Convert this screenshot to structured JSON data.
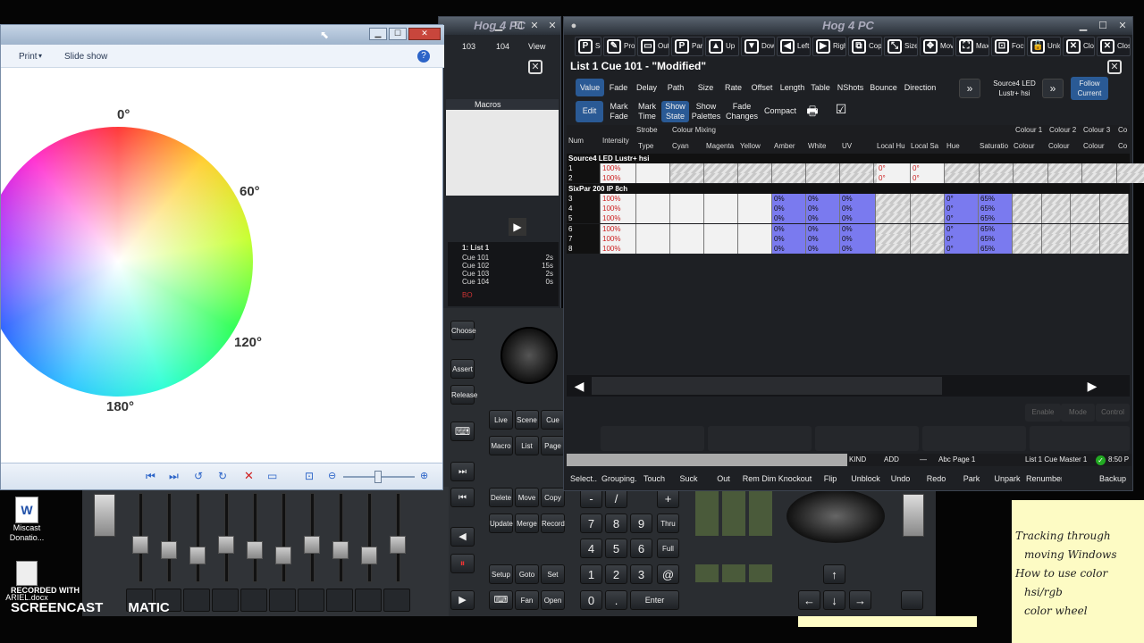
{
  "left_hog_window": {
    "title": "Hog 4 PC",
    "top_buttons": [
      "103",
      "104",
      "View"
    ],
    "macros_header": "Macros",
    "cue_list": {
      "title": "1: List 1",
      "rows": [
        {
          "name": "Cue 101",
          "time": "2s"
        },
        {
          "name": "Cue 102",
          "time": "15s"
        },
        {
          "name": "Cue 103",
          "time": "2s"
        },
        {
          "name": "Cue 104",
          "time": "0s"
        }
      ],
      "status": "BO"
    }
  },
  "photo_viewer": {
    "menu": {
      "print": "Print",
      "slideshow": "Slide show"
    },
    "wheel_labels": {
      "deg0": "0°",
      "deg60": "60°",
      "deg120": "120°",
      "deg180": "180°"
    }
  },
  "main_window": {
    "title": "Hog 4 PC",
    "toolbar": [
      "Sel",
      "Progr",
      "Outpu",
      "Parke",
      "Up",
      "Dow",
      "Left",
      "Righ",
      "Copy",
      "Size",
      "Move",
      "Max",
      "Focu",
      "Unloc",
      "Close",
      "Close"
    ],
    "list_title": "List 1 Cue 101 - \"Modified\"",
    "tabs_row1": [
      "Value",
      "Fade",
      "Delay",
      "Path",
      "Size",
      "Rate",
      "Offset",
      "Length",
      "Table",
      "NShots",
      "Bounce",
      "Direction"
    ],
    "fixture_select": "Source4 LED Lustr+ hsi",
    "follow_current": "Follow Current",
    "tabs_row2": [
      "Edit",
      "Mark Fade",
      "Mark Time",
      "Show State",
      "Show Palettes",
      "Fade Changes",
      "Compact"
    ],
    "groups": {
      "strobe": "Strobe",
      "colour_mixing": "Colour Mixing",
      "colour1": "Colour 1",
      "colour2": "Colour 2",
      "colour3": "Colour 3",
      "co": "Co"
    },
    "columns": [
      "Num",
      "Intensity",
      "Type",
      "Cyan",
      "Magenta",
      "Yellow",
      "Amber",
      "White",
      "UV",
      "Local Hu",
      "Local Sa",
      "Hue",
      "Saturatio",
      "Colour",
      "Colour",
      "Colour",
      "Co"
    ],
    "section1": "Source4 LED Lustr+ hsi",
    "section1_rows": [
      {
        "num": "1",
        "intensity": "100%",
        "lhue": "0°",
        "lsat": "0°"
      },
      {
        "num": "2",
        "intensity": "100%",
        "lhue": "0°",
        "lsat": "0°"
      }
    ],
    "section2": "SixPar 200 IP 8ch",
    "section2_rows": [
      {
        "num": "3",
        "intensity": "100%",
        "amber": "0%",
        "white": "0%",
        "uv": "0%",
        "hue": "0°",
        "sat": "65%"
      },
      {
        "num": "4",
        "intensity": "100%",
        "amber": "0%",
        "white": "0%",
        "uv": "0%",
        "hue": "0°",
        "sat": "65%"
      },
      {
        "num": "5",
        "intensity": "100%",
        "amber": "0%",
        "white": "0%",
        "uv": "0%",
        "hue": "0°",
        "sat": "65%"
      },
      {
        "num": "6",
        "intensity": "100%",
        "amber": "0%",
        "white": "0%",
        "uv": "0%",
        "hue": "0°",
        "sat": "65%"
      },
      {
        "num": "7",
        "intensity": "100%",
        "amber": "0%",
        "white": "0%",
        "uv": "0%",
        "hue": "0°",
        "sat": "65%"
      },
      {
        "num": "8",
        "intensity": "100%",
        "amber": "0%",
        "white": "0%",
        "uv": "0%",
        "hue": "0°",
        "sat": "65%"
      }
    ],
    "bottom_buttons": [
      "Enable",
      "Mode",
      "Control"
    ],
    "status_bar": {
      "kind": "KIND",
      "add": "ADD",
      "dash": "—",
      "page": "Abc Page 1",
      "master": "List 1 Cue Master 1",
      "time": "8:50 P"
    },
    "commands": [
      "Select..",
      "Grouping..",
      "Touch",
      "Suck",
      "Out",
      "Rem Dim",
      "Knockout",
      "Flip",
      "Unblock",
      "Undo",
      "Redo",
      "Park",
      "Unpark",
      "Renumber",
      "Backup"
    ]
  },
  "console": {
    "left_keys": [
      "Choose",
      "Assert",
      "Release"
    ],
    "mid_keys": [
      "Live",
      "Scene",
      "Cue",
      "Macro",
      "List",
      "Page"
    ],
    "edit_keys": [
      "Delete",
      "Move",
      "Copy",
      "Update",
      "Merge",
      "Record"
    ],
    "bottom_keys": [
      "Setup",
      "Goto",
      "Set",
      "Fan",
      "Open"
    ],
    "numpad": [
      "-",
      "/",
      "+",
      "7",
      "8",
      "9",
      "Thru",
      "4",
      "5",
      "6",
      "Full",
      "1",
      "2",
      "3",
      "@",
      "0",
      ".",
      "Enter"
    ],
    "arrows": [
      "←",
      "↓",
      "→",
      "↑"
    ]
  },
  "desktop": {
    "icon1": "Miscast Donatio...",
    "icon2": "ARIEL.docx"
  },
  "sticky_note": [
    "Tracking through",
    "moving Windows",
    "How to use color",
    "hsi/rgb",
    "color wheel"
  ],
  "watermark": {
    "recorded": "RECORDED WITH",
    "brand": "SCREENCAST",
    "brand2": "MATIC"
  }
}
